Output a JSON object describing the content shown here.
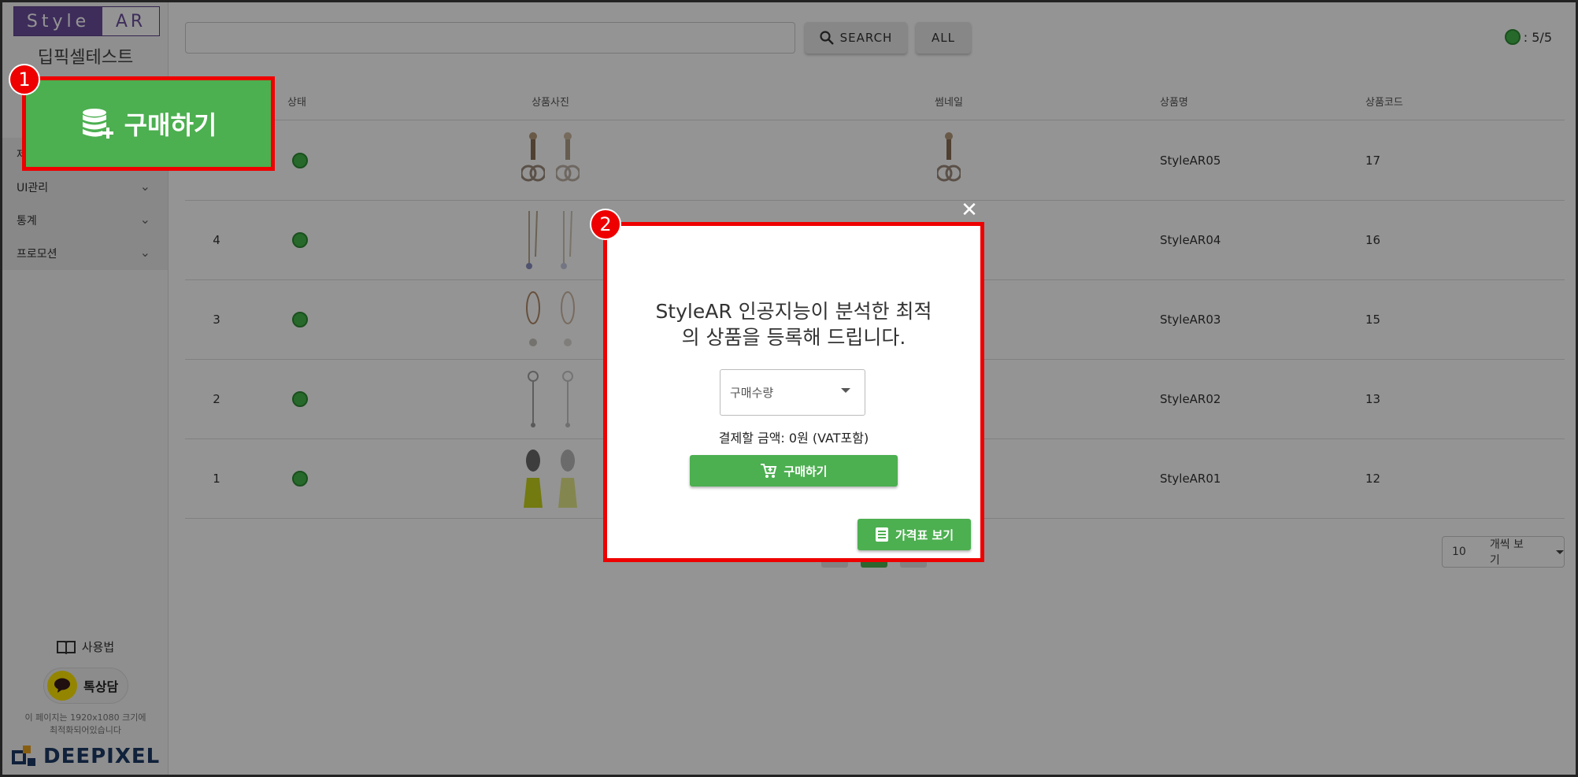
{
  "sidebar": {
    "logo_left": "Style",
    "logo_right": "AR",
    "company_name": "딥픽셀테스트",
    "menu": [
      {
        "label": "제"
      },
      {
        "label": "UI관리"
      },
      {
        "label": "통계"
      },
      {
        "label": "프로모션"
      }
    ],
    "help_label": "사용법",
    "kakao_label": "톡상담",
    "notice_line1": "이 페이지는 1920x1080 크기에",
    "notice_line2": "최적화되어있습니다",
    "brand_label": "DEEPIXEL"
  },
  "toolbar": {
    "search_value": "",
    "search_label": "SEARCH",
    "all_label": "ALL",
    "status_count": ": 5/5"
  },
  "table": {
    "headers": {
      "status": "상태",
      "photo": "상품사진",
      "thumbnail": "썸네일",
      "name": "상품명",
      "code": "상품코드"
    },
    "rows": [
      {
        "num": "",
        "name": "StyleAR05",
        "code": "17"
      },
      {
        "num": "4",
        "name": "StyleAR04",
        "code": "16"
      },
      {
        "num": "3",
        "name": "StyleAR03",
        "code": "15"
      },
      {
        "num": "2",
        "name": "StyleAR02",
        "code": "13"
      },
      {
        "num": "1",
        "name": "StyleAR01",
        "code": "12"
      }
    ]
  },
  "pagination": {
    "page_size": "10",
    "page_size_suffix": "개씩 보기"
  },
  "callouts": {
    "one": "1",
    "two": "2"
  },
  "purchase_button": {
    "label": "구매하기"
  },
  "modal": {
    "title_line1": "StyleAR 인공지능이 분석한 최적",
    "title_line2": "의 상품을 등록해 드립니다.",
    "quantity_placeholder": "구매수량",
    "amount_text": "결제할 금액: 0원 (VAT포함)",
    "buy_label": "구매하기",
    "price_table_label": "가격표 보기",
    "close_glyph": "✕"
  },
  "colors": {
    "accent_green": "#4caf50",
    "highlight_red": "#ee0000",
    "logo_purple": "#6c4f9e"
  }
}
